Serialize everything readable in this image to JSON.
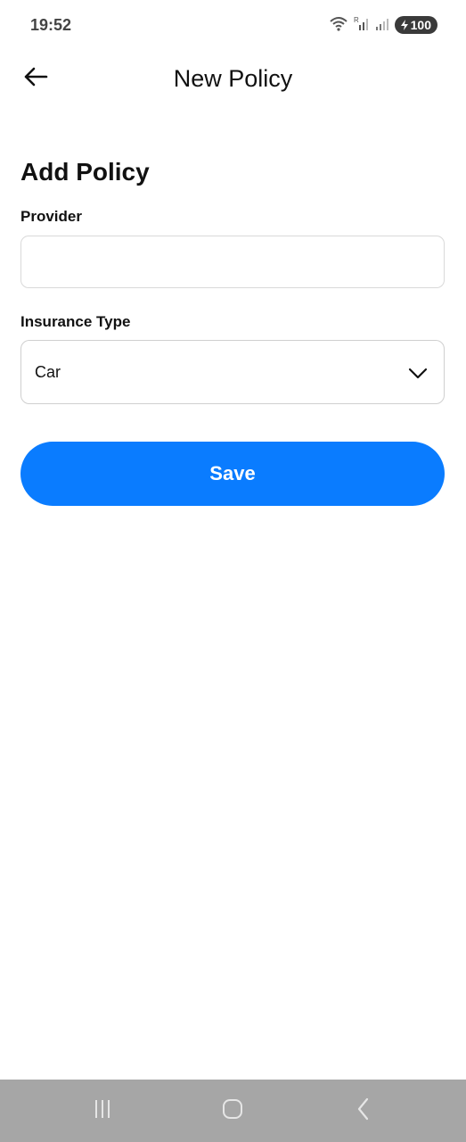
{
  "status_bar": {
    "time": "19:52",
    "battery": "100",
    "icons": [
      "wifi-icon",
      "signal-icon",
      "signal-icon",
      "battery-icon"
    ]
  },
  "app_bar": {
    "title": "New Policy",
    "back_icon": "arrow-left-icon"
  },
  "form": {
    "section_title": "Add Policy",
    "provider": {
      "label": "Provider",
      "value": ""
    },
    "insurance_type": {
      "label": "Insurance Type",
      "selected": "Car",
      "icon": "chevron-down-icon"
    },
    "save_label": "Save"
  },
  "nav_bar": {
    "icons": [
      "recents-icon",
      "home-icon",
      "back-icon"
    ]
  },
  "colors": {
    "accent": "#0a7cff",
    "nav_bar_bg": "#a6a6a6",
    "input_border": "#d9d9d9"
  }
}
